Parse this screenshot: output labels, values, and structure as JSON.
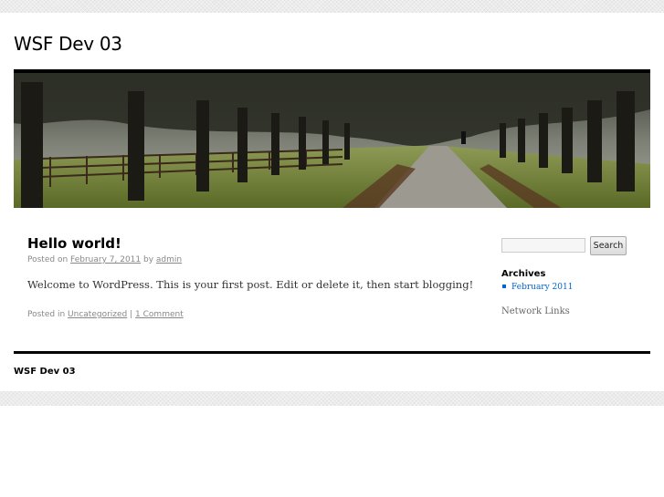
{
  "site": {
    "title": "WSF Dev 03"
  },
  "post": {
    "title": "Hello world!",
    "meta": {
      "posted_on": "Posted on",
      "date": "February 7, 2011",
      "by": "by",
      "author": "admin"
    },
    "content": "Welcome to WordPress. This is your first post. Edit or delete it, then start blogging!",
    "utility": {
      "posted_in": "Posted in",
      "category": "Uncategorized",
      "separator": "|",
      "comments": "1 Comment"
    }
  },
  "sidebar": {
    "search": {
      "value": "",
      "button_label": "Search"
    },
    "archives": {
      "title": "Archives",
      "items": [
        "February 2011"
      ]
    },
    "network_links": "Network Links"
  },
  "footer": {
    "title": "WSF Dev 03"
  },
  "colors": {
    "link_blue": "#0066cc",
    "meta_gray": "#888888",
    "rule_black": "#000000"
  },
  "header_image": {
    "icon": "tree-lined-path-photo"
  }
}
